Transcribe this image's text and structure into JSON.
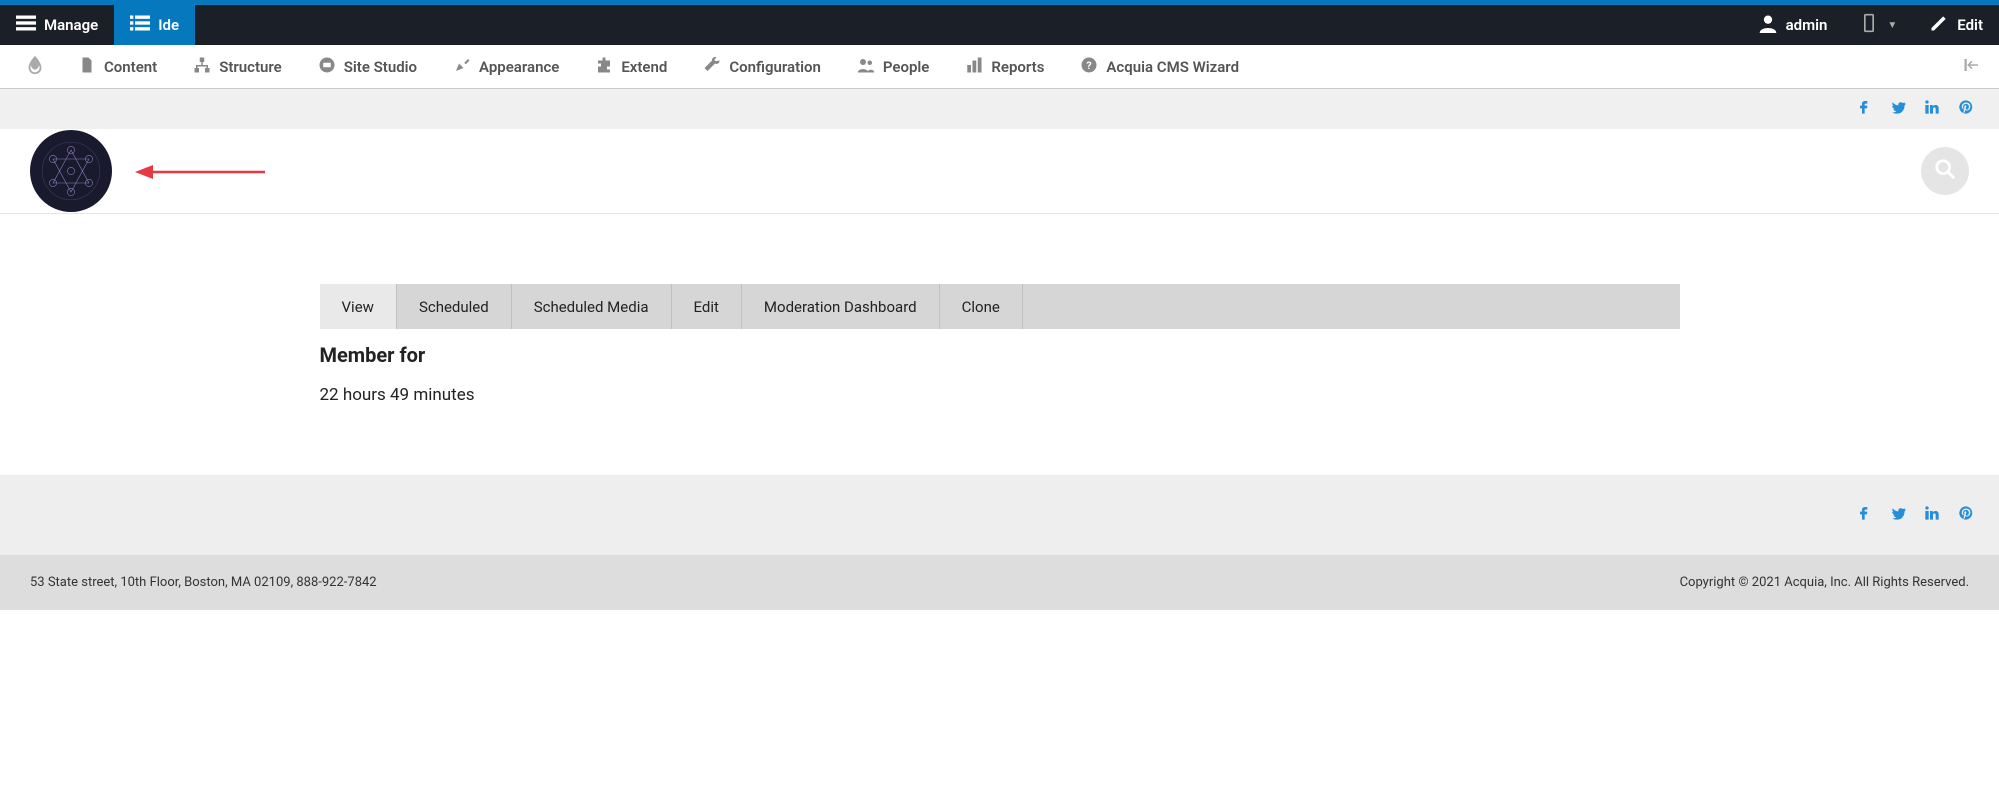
{
  "toolbar": {
    "manage_label": "Manage",
    "ide_label": "Ide",
    "user_label": "admin",
    "edit_label": "Edit"
  },
  "admin_menu": {
    "items": [
      {
        "label": "Content"
      },
      {
        "label": "Structure"
      },
      {
        "label": "Site Studio"
      },
      {
        "label": "Appearance"
      },
      {
        "label": "Extend"
      },
      {
        "label": "Configuration"
      },
      {
        "label": "People"
      },
      {
        "label": "Reports"
      },
      {
        "label": "Acquia CMS Wizard"
      }
    ]
  },
  "tabs": [
    {
      "label": "View"
    },
    {
      "label": "Scheduled"
    },
    {
      "label": "Scheduled Media"
    },
    {
      "label": "Edit"
    },
    {
      "label": "Moderation Dashboard"
    },
    {
      "label": "Clone"
    }
  ],
  "profile": {
    "member_for_label": "Member for",
    "member_for_value": "22 hours 49 minutes"
  },
  "footer": {
    "address": "53 State street, 10th Floor, Boston, MA 02109, 888-922-7842",
    "copyright": "Copyright © 2021 Acquia, Inc. All Rights Reserved."
  },
  "colors": {
    "brand_blue": "#0678be",
    "toolbar_bg": "#1b1f27",
    "social_blue": "#268ed9"
  }
}
